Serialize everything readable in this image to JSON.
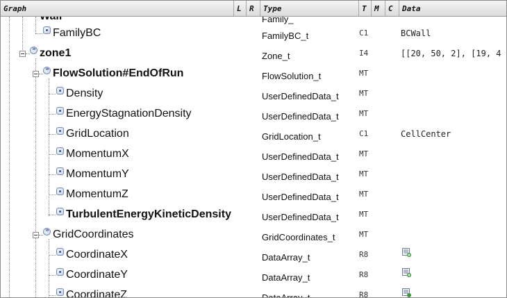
{
  "header": {
    "graph": "Graph",
    "l": "L",
    "r": "R",
    "type": "Type",
    "t": "T",
    "m": "M",
    "c": "C",
    "data": "Data"
  },
  "rows": [
    {
      "name": "Wall",
      "type": "Family_",
      "tcode": "",
      "data": "",
      "bold": true
    },
    {
      "name": "FamilyBC",
      "type": "FamilyBC_t",
      "tcode": "C1",
      "data": "BCWall"
    },
    {
      "name": "zone1",
      "type": "Zone_t",
      "tcode": "I4",
      "data": "[[20, 50, 2], [19, 4"
    },
    {
      "name": "FlowSolution#EndOfRun",
      "type": "FlowSolution_t",
      "tcode": "MT",
      "data": ""
    },
    {
      "name": "Density",
      "type": "UserDefinedData_t",
      "tcode": "MT",
      "data": ""
    },
    {
      "name": "EnergyStagnationDensity",
      "type": "UserDefinedData_t",
      "tcode": "MT",
      "data": ""
    },
    {
      "name": "GridLocation",
      "type": "GridLocation_t",
      "tcode": "C1",
      "data": "CellCenter"
    },
    {
      "name": "MomentumX",
      "type": "UserDefinedData_t",
      "tcode": "MT",
      "data": ""
    },
    {
      "name": "MomentumY",
      "type": "UserDefinedData_t",
      "tcode": "MT",
      "data": ""
    },
    {
      "name": "MomentumZ",
      "type": "UserDefinedData_t",
      "tcode": "MT",
      "data": ""
    },
    {
      "name": "TurbulentEnergyKineticDensity",
      "type": "UserDefinedData_t",
      "tcode": "MT",
      "data": ""
    },
    {
      "name": "GridCoordinates",
      "type": "GridCoordinates_t",
      "tcode": "MT",
      "data": ""
    },
    {
      "name": "CoordinateX",
      "type": "DataArray_t",
      "tcode": "R8",
      "data": ""
    },
    {
      "name": "CoordinateY",
      "type": "DataArray_t",
      "tcode": "R8",
      "data": ""
    },
    {
      "name": "CoordinateZ",
      "type": "DataArray_t",
      "tcode": "R8",
      "data": ""
    }
  ],
  "icons": {
    "leaf": "leaf-node-icon",
    "branch": "branch-node-icon",
    "array": "data-array-icon"
  },
  "colors": {
    "header_bg": "#dcdcdc",
    "node_icon": "#b8c8e6",
    "array_icon": "#3a9a3a"
  }
}
